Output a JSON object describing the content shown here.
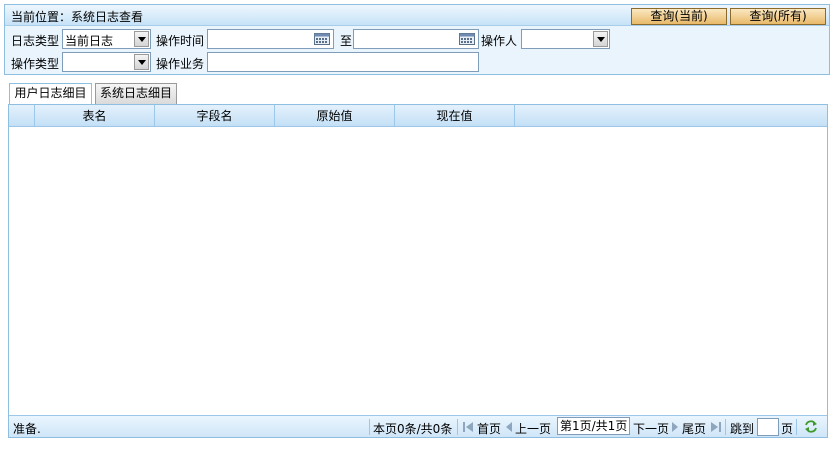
{
  "header": {
    "title": "当前位置：系统日志查看",
    "btn_current": "查询(当前)",
    "btn_all": "查询(所有)"
  },
  "filters": {
    "log_type_label": "日志类型",
    "log_type_value": "当前日志",
    "op_time_label": "操作时间",
    "to_label": "至",
    "operator_label": "操作人",
    "op_type_label": "操作类型",
    "op_business_label": "操作业务"
  },
  "tabs": [
    "用户日志细目",
    "系统日志细目"
  ],
  "grid": {
    "columns": [
      "表名",
      "字段名",
      "原始值",
      "现在值"
    ]
  },
  "status": {
    "ready": "准备.",
    "count": "本页0条/共0条",
    "first": "首页",
    "prev": "上一页",
    "page": "第1页/共1页",
    "next": "下一页",
    "last": "尾页",
    "jump": "跳到",
    "jump_unit": "页"
  },
  "colors": {
    "accent": "#8fbfe0",
    "button": "#e8b96a"
  }
}
